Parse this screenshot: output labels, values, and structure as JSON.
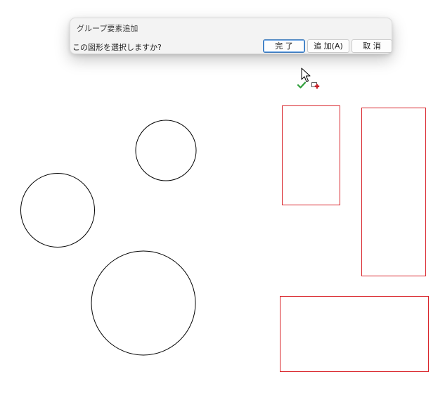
{
  "dialog": {
    "title": "グループ要素追加",
    "prompt": "この図形を選択しますか?",
    "buttons": {
      "done": "完 了",
      "add": "追 加(A)",
      "cancel": "取 消"
    }
  },
  "cursor": {
    "icon": "arrow-cursor-icon",
    "badges": [
      "green-check-icon",
      "add-to-group-icon"
    ]
  },
  "canvas": {
    "shapes": [
      {
        "type": "circle",
        "stroke": "#000000",
        "selected": false
      },
      {
        "type": "circle",
        "stroke": "#000000",
        "selected": false
      },
      {
        "type": "circle",
        "stroke": "#000000",
        "selected": false
      },
      {
        "type": "rectangle",
        "stroke": "#d9262c",
        "selected": true
      },
      {
        "type": "rectangle",
        "stroke": "#d9262c",
        "selected": true
      },
      {
        "type": "rectangle",
        "stroke": "#d9262c",
        "selected": true
      }
    ]
  },
  "colors": {
    "selected_stroke": "#d9262c",
    "default_stroke": "#000000",
    "primary_button_border": "#2a6fb8"
  }
}
